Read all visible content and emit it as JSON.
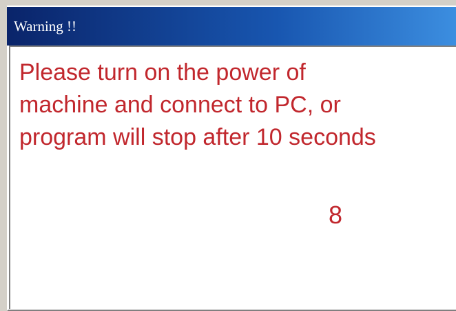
{
  "window": {
    "title": "Warning !!"
  },
  "message": {
    "lines": [
      "Please turn on the power of",
      "machine and connect to PC, or",
      "program will stop after 10 seconds"
    ],
    "color": "#c1272d"
  },
  "countdown": {
    "value": "8"
  },
  "colors": {
    "title_bar_start": "#0a246a",
    "title_bar_end": "#3c8ee0",
    "title_text": "#ffffff",
    "background": "#ffffff"
  }
}
